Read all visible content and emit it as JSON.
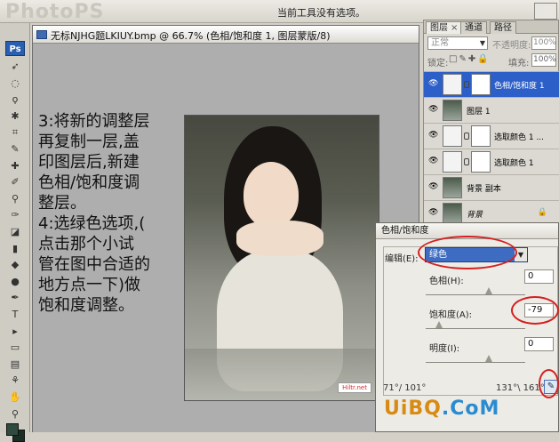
{
  "top_bar": {
    "logo_text": "PhotoPS",
    "hint": "当前工具没有选项。"
  },
  "toolbox": {
    "badge": "Ps",
    "tools": [
      {
        "icon": "move-icon",
        "glyph": "➶"
      },
      {
        "icon": "marquee-icon",
        "glyph": "◌"
      },
      {
        "icon": "lasso-icon",
        "glyph": "ϙ"
      },
      {
        "icon": "magic-wand-icon",
        "glyph": "✱"
      },
      {
        "icon": "crop-icon",
        "glyph": "⌗"
      },
      {
        "icon": "slice-icon",
        "glyph": "✎"
      },
      {
        "icon": "healing-icon",
        "glyph": "✚"
      },
      {
        "icon": "brush-icon",
        "glyph": "✐"
      },
      {
        "icon": "stamp-icon",
        "glyph": "⚲"
      },
      {
        "icon": "history-brush-icon",
        "glyph": "✑"
      },
      {
        "icon": "eraser-icon",
        "glyph": "◪"
      },
      {
        "icon": "gradient-icon",
        "glyph": "▮"
      },
      {
        "icon": "blur-icon",
        "glyph": "◆"
      },
      {
        "icon": "dodge-icon",
        "glyph": "●"
      },
      {
        "icon": "pen-icon",
        "glyph": "✒"
      },
      {
        "icon": "type-icon",
        "glyph": "T"
      },
      {
        "icon": "path-select-icon",
        "glyph": "▸"
      },
      {
        "icon": "shape-icon",
        "glyph": "▭"
      },
      {
        "icon": "notes-icon",
        "glyph": "▤"
      },
      {
        "icon": "eyedropper-icon",
        "glyph": "⚘"
      },
      {
        "icon": "hand-icon",
        "glyph": "✋"
      },
      {
        "icon": "zoom-icon",
        "glyph": "⚲"
      }
    ]
  },
  "document": {
    "title": "无标NJHG题LKIUY.bmp @ 66.7% (色相/饱和度 1, 图层蒙版/8)",
    "instructions": [
      "3:将新的调整层",
      "再复制一层,盖",
      "印图层后,新建",
      "色相/饱和度调",
      "整层。",
      "4:选绿色选项,(",
      "点击那个小试",
      "管在图中合适的",
      "地方点一下)做",
      "饱和度调整。"
    ],
    "photo_credit": "Hiltr.net"
  },
  "layers_panel": {
    "tabs": [
      {
        "label": "图层",
        "close": "×"
      },
      {
        "label": "通道",
        "close": ""
      },
      {
        "label": "路径",
        "close": ""
      }
    ],
    "blend_mode": "正常",
    "opacity_label": "不透明度:",
    "opacity_value": "100%",
    "lock_label": "锁定:",
    "lock_icons": "□✎✚🔒",
    "fill_label": "填充:",
    "fill_value": "100%",
    "layers": [
      {
        "name": "色相/饱和度 1",
        "kind": "adjustment",
        "selected": true
      },
      {
        "name": "图层 1",
        "kind": "pixel",
        "selected": false
      },
      {
        "name": "选取颜色 1 ...",
        "kind": "adjustment",
        "selected": false
      },
      {
        "name": "选取颜色 1",
        "kind": "adjustment",
        "selected": false
      },
      {
        "name": "背景 副本",
        "kind": "pixel",
        "selected": false
      },
      {
        "name": "背景",
        "kind": "background",
        "selected": false,
        "locked": true
      }
    ]
  },
  "hue_sat_dialog": {
    "title": "色相/饱和度",
    "edit_label": "编辑(E):",
    "edit_value": "绿色",
    "hue_label": "色相(H):",
    "hue_value": "0",
    "saturation_label": "饱和度(A):",
    "saturation_value": "-79",
    "lightness_label": "明度(I):",
    "lightness_value": "0",
    "range_left": "71°/ 101°",
    "range_right": "131°\\ 161°"
  },
  "watermark": {
    "part_a": "UiBQ",
    "part_b": ".CoM"
  },
  "colors": {
    "selection_blue": "#2c5fc7",
    "annotation_red": "#d42020"
  }
}
